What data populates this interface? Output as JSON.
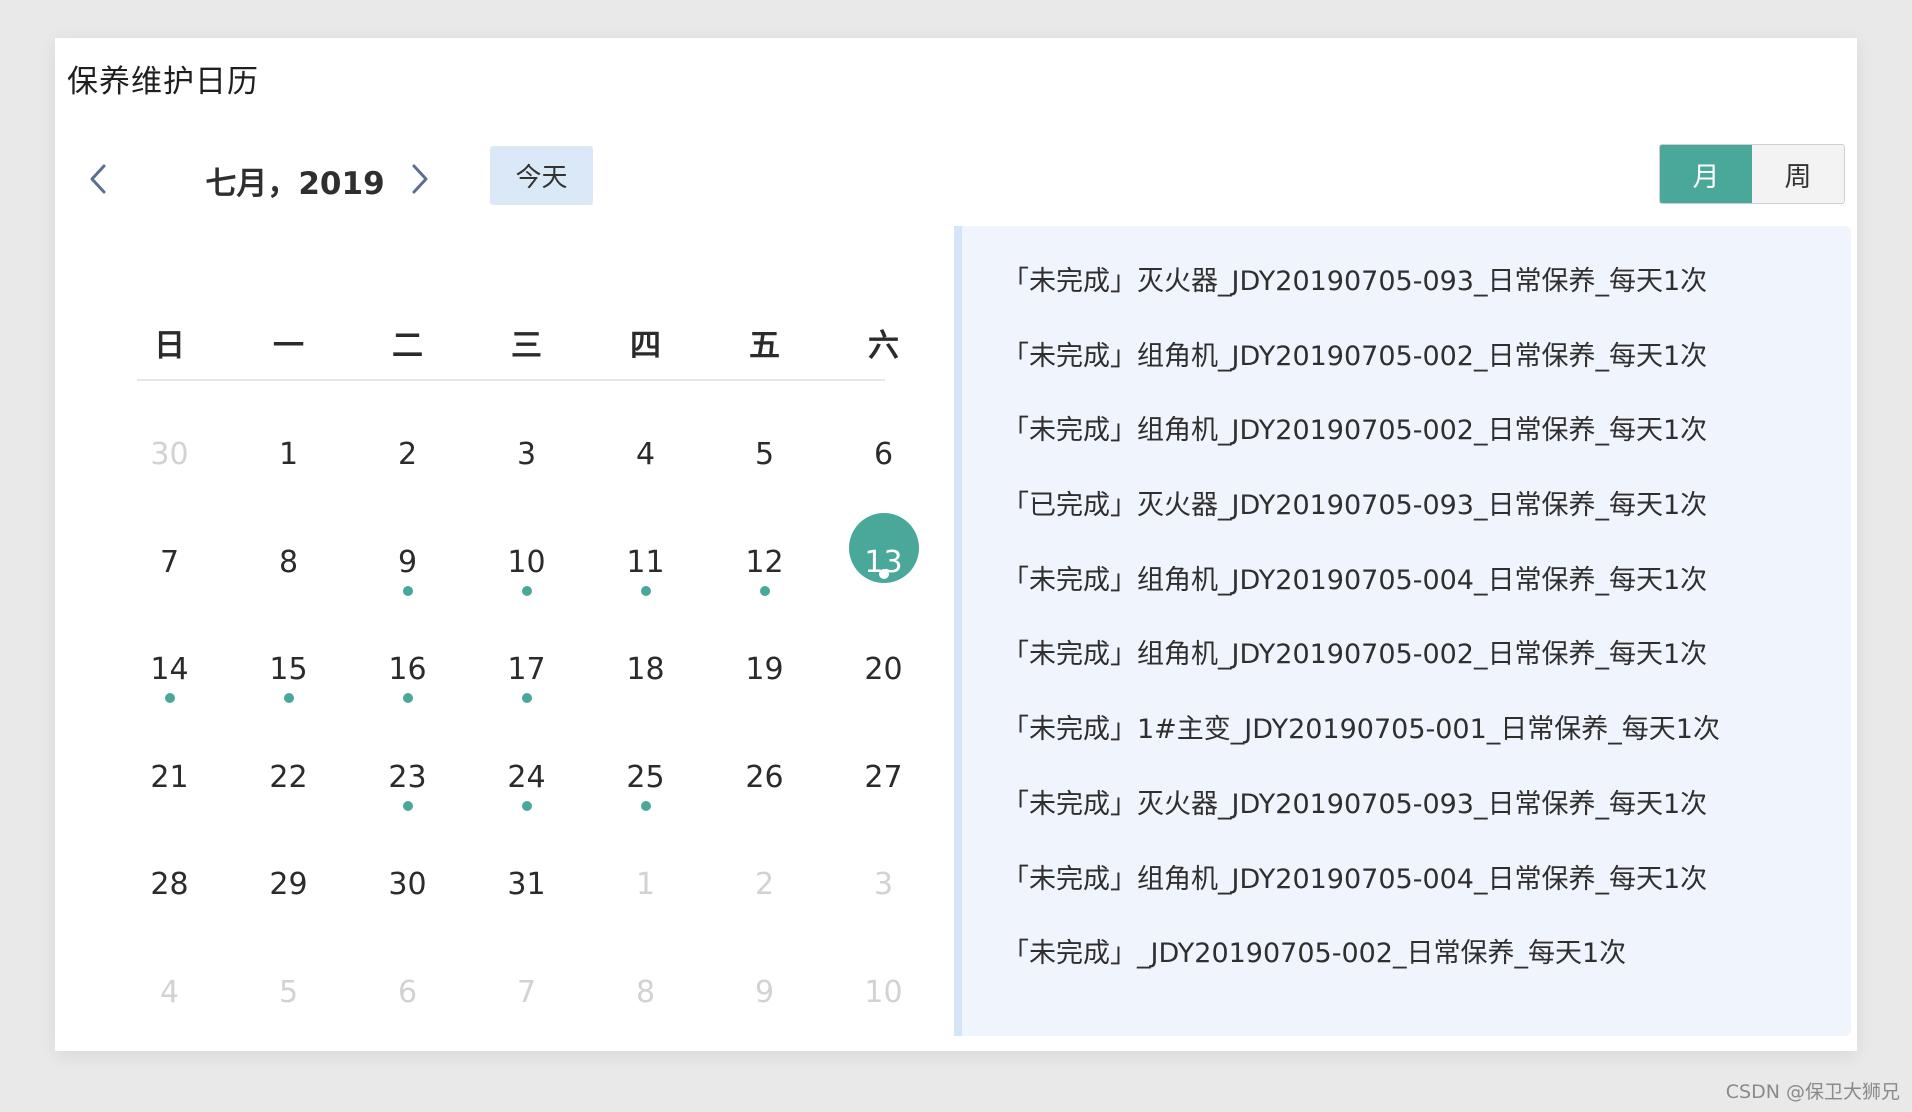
{
  "card": {
    "title": "保养维护日历"
  },
  "toolbar": {
    "month_label": "七月，2019",
    "today_label": "今天",
    "views": [
      {
        "label": "月",
        "active": true
      },
      {
        "label": "周",
        "active": false
      }
    ]
  },
  "calendar": {
    "weekdays": [
      "日",
      "一",
      "二",
      "三",
      "四",
      "五",
      "六"
    ],
    "weeks": [
      [
        {
          "d": "30",
          "other": true
        },
        {
          "d": "1"
        },
        {
          "d": "2"
        },
        {
          "d": "3"
        },
        {
          "d": "4"
        },
        {
          "d": "5"
        },
        {
          "d": "6"
        }
      ],
      [
        {
          "d": "7"
        },
        {
          "d": "8"
        },
        {
          "d": "9",
          "dot": true
        },
        {
          "d": "10",
          "dot": true
        },
        {
          "d": "11",
          "dot": true
        },
        {
          "d": "12",
          "dot": true
        },
        {
          "d": "13",
          "dot": true,
          "selected": true
        }
      ],
      [
        {
          "d": "14",
          "dot": true
        },
        {
          "d": "15",
          "dot": true
        },
        {
          "d": "16",
          "dot": true
        },
        {
          "d": "17",
          "dot": true
        },
        {
          "d": "18"
        },
        {
          "d": "19"
        },
        {
          "d": "20"
        }
      ],
      [
        {
          "d": "21"
        },
        {
          "d": "22"
        },
        {
          "d": "23",
          "dot": true
        },
        {
          "d": "24",
          "dot": true
        },
        {
          "d": "25",
          "dot": true
        },
        {
          "d": "26"
        },
        {
          "d": "27"
        }
      ],
      [
        {
          "d": "28"
        },
        {
          "d": "29"
        },
        {
          "d": "30"
        },
        {
          "d": "31"
        },
        {
          "d": "1",
          "other": true
        },
        {
          "d": "2",
          "other": true
        },
        {
          "d": "3",
          "other": true
        }
      ],
      [
        {
          "d": "4",
          "other": true
        },
        {
          "d": "5",
          "other": true
        },
        {
          "d": "6",
          "other": true
        },
        {
          "d": "7",
          "other": true
        },
        {
          "d": "8",
          "other": true
        },
        {
          "d": "9",
          "other": true
        },
        {
          "d": "10",
          "other": true
        }
      ]
    ],
    "accent_color": "#4aa89a"
  },
  "tasks": [
    "「未完成」灭火器_JDY20190705-093_日常保养_每天1次",
    "「未完成」组角机_JDY20190705-002_日常保养_每天1次",
    "「未完成」组角机_JDY20190705-002_日常保养_每天1次",
    "「已完成」灭火器_JDY20190705-093_日常保养_每天1次",
    "「未完成」组角机_JDY20190705-004_日常保养_每天1次",
    "「未完成」组角机_JDY20190705-002_日常保养_每天1次",
    "「未完成」1#主变_JDY20190705-001_日常保养_每天1次",
    "「未完成」灭火器_JDY20190705-093_日常保养_每天1次",
    "「未完成」组角机_JDY20190705-004_日常保养_每天1次",
    "「未完成」_JDY20190705-002_日常保养_每天1次"
  ],
  "watermark": "CSDN @保卫大狮兄"
}
